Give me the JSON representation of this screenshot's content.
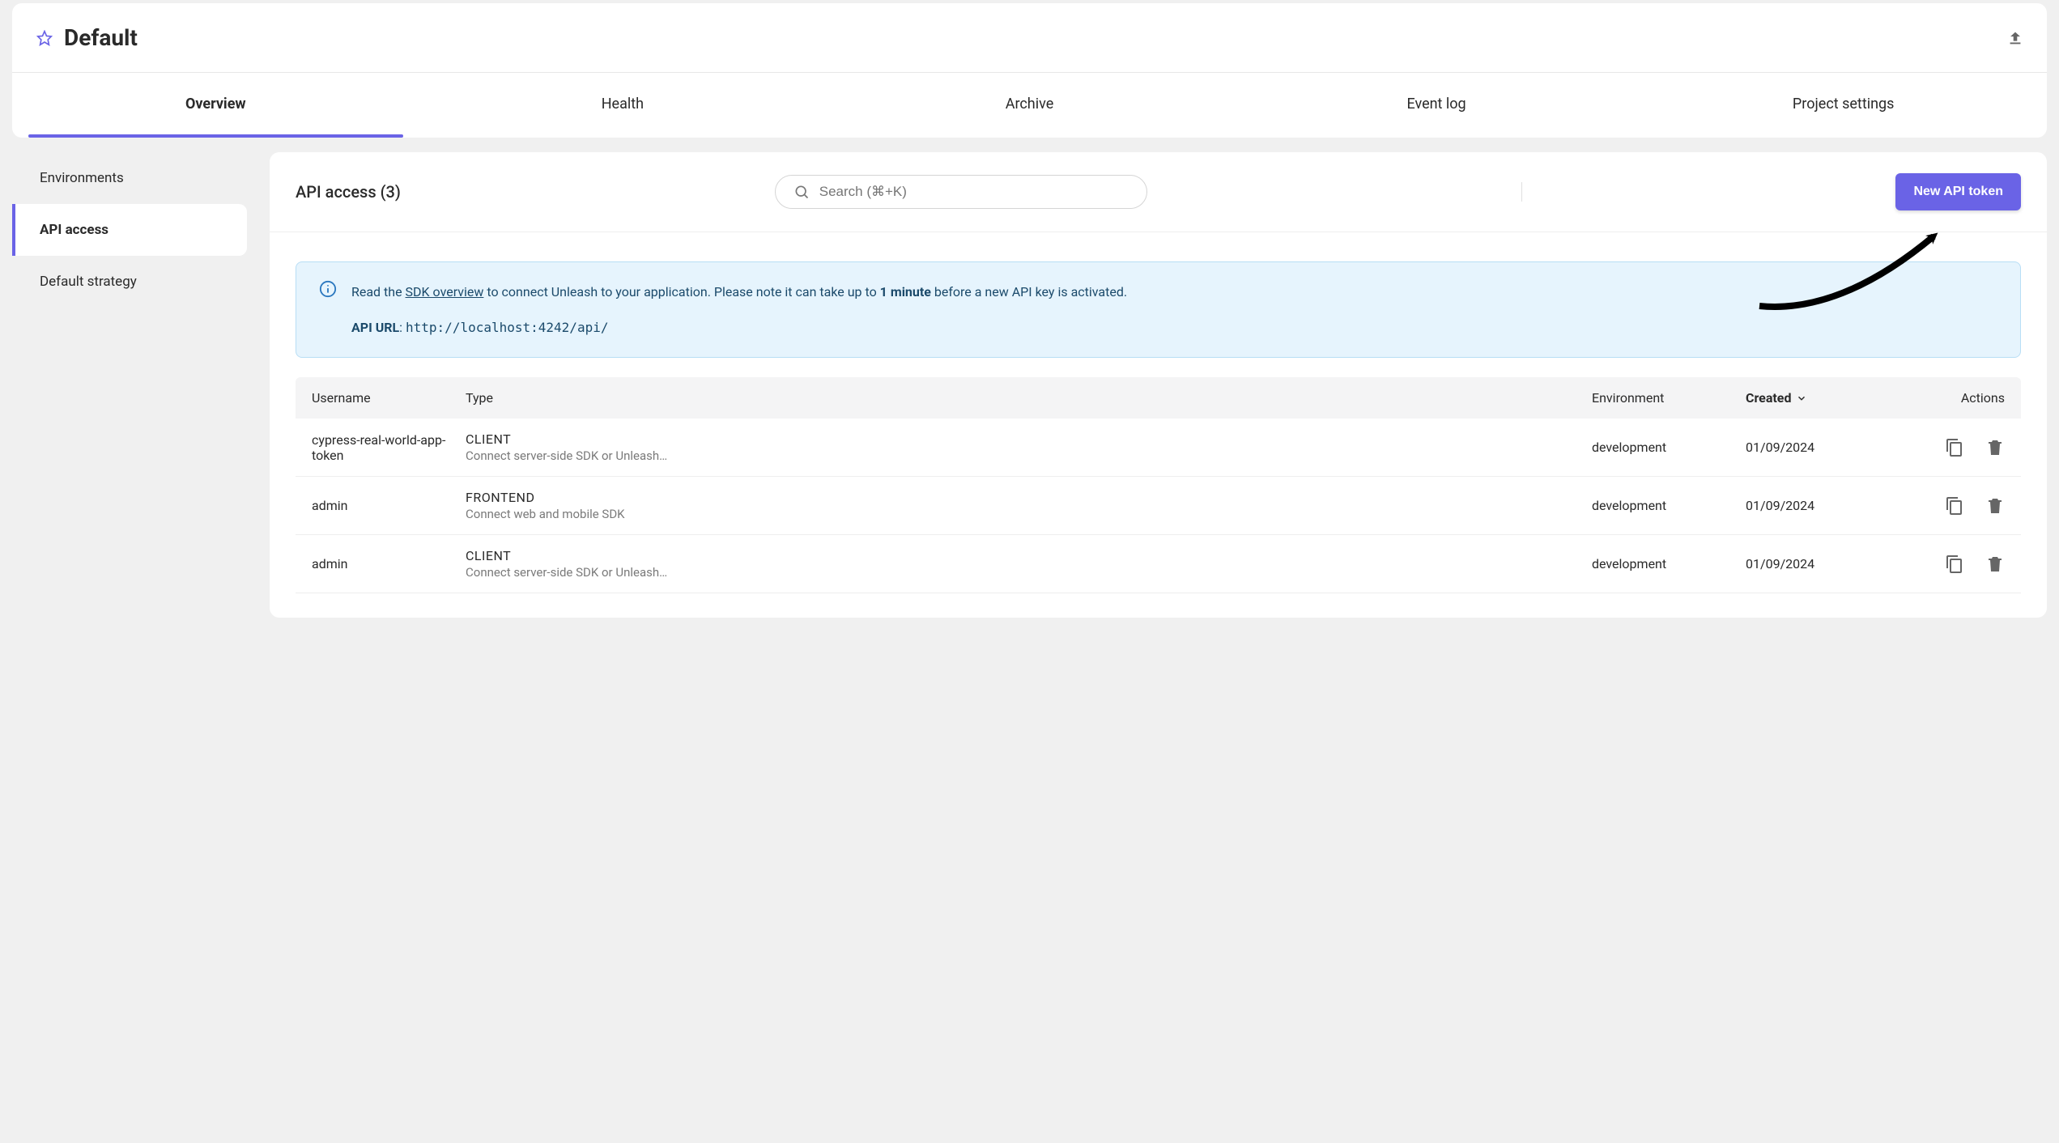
{
  "project": {
    "title": "Default"
  },
  "tabs": {
    "overview": "Overview",
    "health": "Health",
    "archive": "Archive",
    "event_log": "Event log",
    "project_settings": "Project settings"
  },
  "sidebar": {
    "environments": "Environments",
    "api_access": "API access",
    "default_strategy": "Default strategy"
  },
  "api_access": {
    "title": "API access (3)",
    "search_placeholder": "Search (⌘+K)",
    "new_token_button": "New API token"
  },
  "info_banner": {
    "pre": "Read the ",
    "link": "SDK overview",
    "mid": " to connect Unleash to your application. Please note it can take up to ",
    "bold": "1 minute",
    "post": " before a new API key is activated.",
    "api_url_label": "API URL",
    "api_url_value": "http://localhost:4242/api/"
  },
  "table": {
    "headers": {
      "username": "Username",
      "type": "Type",
      "environment": "Environment",
      "created": "Created",
      "actions": "Actions"
    },
    "rows": [
      {
        "username": "cypress-real-world-app-token",
        "type": "CLIENT",
        "type_desc": "Connect server-side SDK or Unleash…",
        "environment": "development",
        "created": "01/09/2024"
      },
      {
        "username": "admin",
        "type": "FRONTEND",
        "type_desc": "Connect web and mobile SDK",
        "environment": "development",
        "created": "01/09/2024"
      },
      {
        "username": "admin",
        "type": "CLIENT",
        "type_desc": "Connect server-side SDK or Unleash…",
        "environment": "development",
        "created": "01/09/2024"
      }
    ]
  }
}
